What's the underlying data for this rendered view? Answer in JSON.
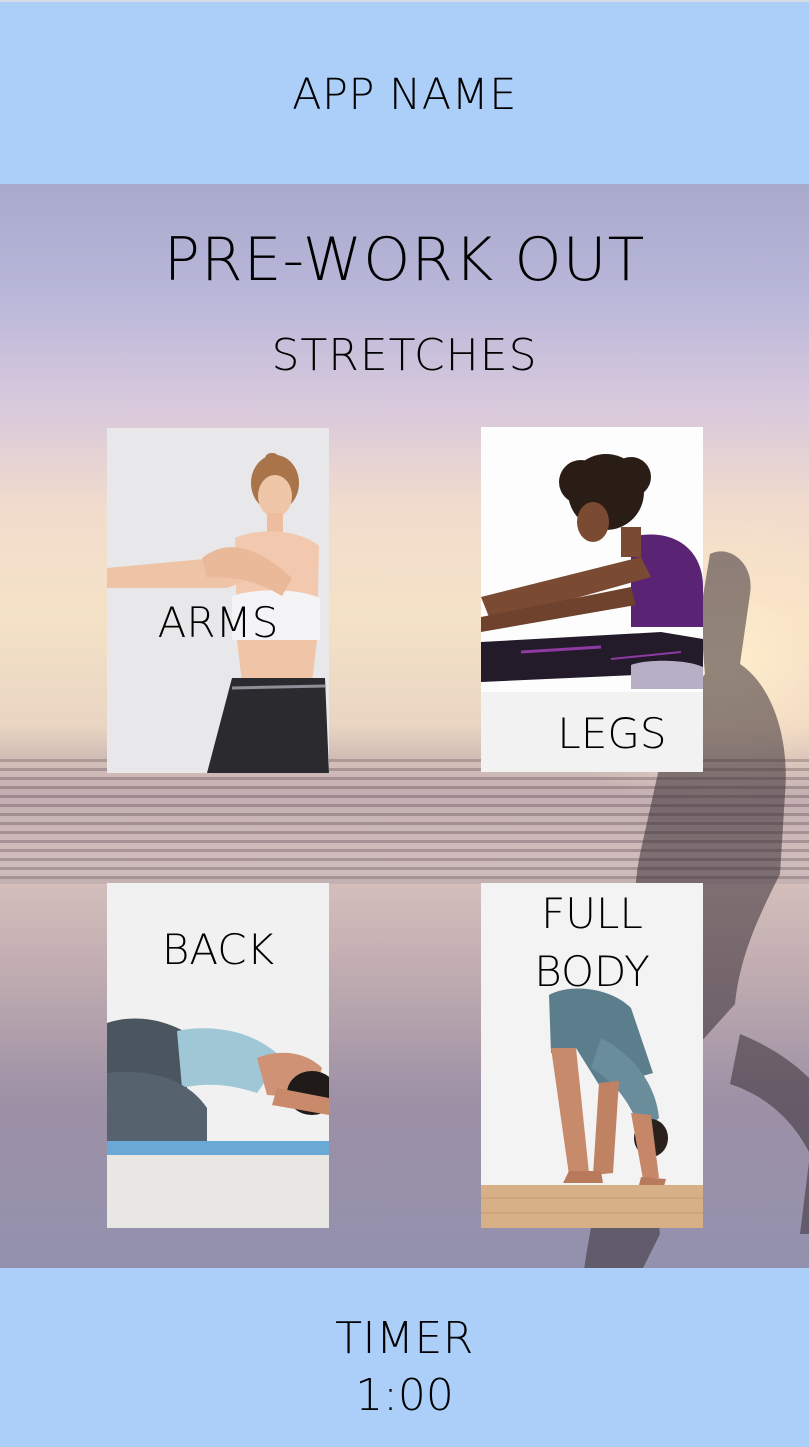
{
  "header": {
    "app_name": "APP NAME"
  },
  "hero": {
    "title": "PRE-WORK OUT",
    "subtitle": "STRETCHES"
  },
  "cards": [
    {
      "label": "ARMS",
      "photo": "woman-arm-stretch"
    },
    {
      "label": "LEGS",
      "photo": "woman-hamstring-stretch"
    },
    {
      "label": "BACK",
      "photo": "child-pose-stretch"
    },
    {
      "label": "FULL\nBODY",
      "photo": "forward-fold-stretch"
    }
  ],
  "footer": {
    "timer_label": "TIMER",
    "timer_value": "1:00"
  },
  "colors": {
    "bar_background": "#abcff8",
    "text": "#000000"
  }
}
